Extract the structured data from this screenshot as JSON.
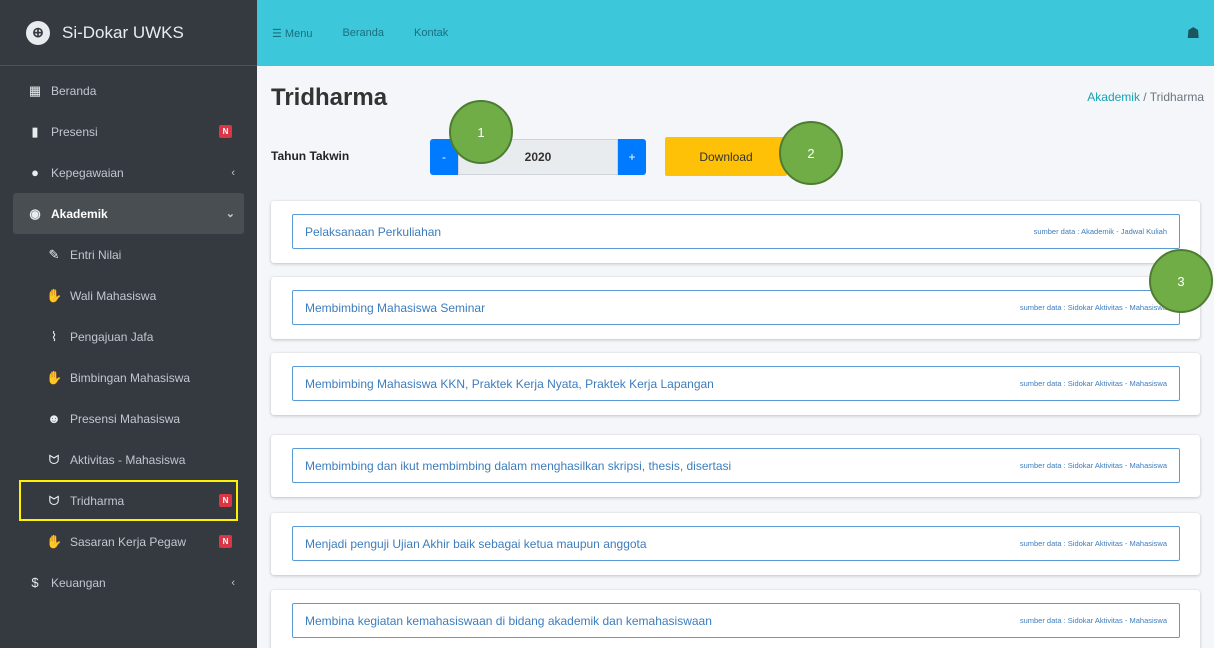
{
  "brand": {
    "name": "Si-Dokar UWKS",
    "logo_letter": "⊕"
  },
  "sidebar": {
    "items": [
      {
        "label": "Beranda",
        "icon": "grid-icon",
        "glyph": "▦"
      },
      {
        "label": "Presensi",
        "icon": "building-icon",
        "glyph": "▮",
        "badge": "N"
      },
      {
        "label": "Kepegawaian",
        "icon": "user-icon",
        "glyph": "●",
        "chevron": "‹"
      },
      {
        "label": "Akademik",
        "icon": "graduation-icon",
        "glyph": "◉",
        "chevron": "⌄"
      },
      {
        "label": "Entri Nilai",
        "icon": "edit-icon",
        "glyph": "✎"
      },
      {
        "label": "Wali Mahasiswa",
        "icon": "handshake-icon",
        "glyph": "✋"
      },
      {
        "label": "Pengajuan Jafa",
        "icon": "chart-icon",
        "glyph": "⌇"
      },
      {
        "label": "Bimbingan Mahasiswa",
        "icon": "handshake-icon",
        "glyph": "✋"
      },
      {
        "label": "Presensi Mahasiswa",
        "icon": "user-check-icon",
        "glyph": "☻"
      },
      {
        "label": "Aktivitas - Mahasiswa",
        "icon": "hands-icon",
        "glyph": "ᗢ"
      },
      {
        "label": "Tridharma",
        "icon": "hands-icon",
        "glyph": "ᗢ",
        "badge": "N"
      },
      {
        "label": "Sasaran Kerja Pegaw",
        "icon": "handshake-icon",
        "glyph": "✋",
        "badge": "N"
      },
      {
        "label": "Keuangan",
        "icon": "dollar-icon",
        "glyph": "$",
        "chevron": "‹"
      }
    ]
  },
  "topbar": {
    "menu": "☰ Menu",
    "home": "Beranda",
    "contact": "Kontak",
    "user_icon": "☗"
  },
  "page": {
    "title": "Tridharma",
    "breadcrumb_parent": "Akademik",
    "breadcrumb_sep": "/",
    "breadcrumb_current": "Tridharma"
  },
  "filter": {
    "label": "Tahun Takwin",
    "minus": "-",
    "plus": "+",
    "year": "2020",
    "download": "Download"
  },
  "markers": [
    "1",
    "2",
    "3"
  ],
  "cards": [
    {
      "title": "Pelaksanaan Perkuliahan",
      "source": "sumber data : Akademik - Jadwal Kuliah"
    },
    {
      "title": "Membimbing Mahasiswa Seminar",
      "source": "sumber data : Sidokar Aktivitas - Mahasiswa"
    },
    {
      "title": "Membimbing Mahasiswa KKN, Praktek Kerja Nyata, Praktek Kerja Lapangan",
      "source": "sumber data : Sidokar Aktivitas - Mahasiswa"
    },
    {
      "title": "Membimbing dan ikut membimbing dalam menghasilkan skripsi, thesis, disertasi",
      "source": "sumber data : Sidokar Aktivitas - Mahasiswa"
    },
    {
      "title": "Menjadi penguji Ujian Akhir baik sebagai ketua maupun anggota",
      "source": "sumber data : Sidokar Aktivitas - Mahasiswa"
    },
    {
      "title": "Membina kegiatan kemahasiswaan di bidang akademik dan kemahasiswaan",
      "source": "sumber data : Sidokar Aktivitas - Mahasiswa"
    }
  ]
}
